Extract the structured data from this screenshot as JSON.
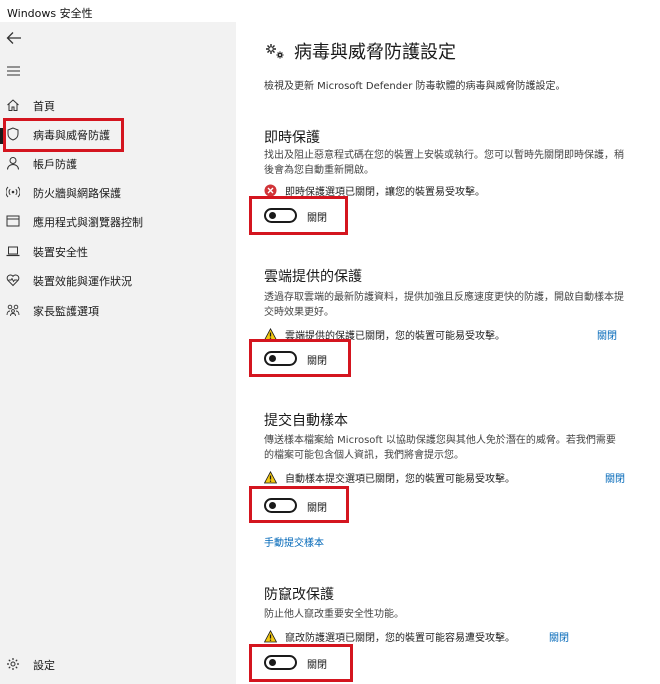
{
  "window": {
    "title": "Windows 安全性"
  },
  "sidebar": {
    "items": [
      {
        "label": "首頁",
        "icon": "home-icon"
      },
      {
        "label": "病毒與威脅防護",
        "icon": "shield-icon"
      },
      {
        "label": "帳戶防護",
        "icon": "person-icon"
      },
      {
        "label": "防火牆與網路保護",
        "icon": "wifi-icon"
      },
      {
        "label": "應用程式與瀏覽器控制",
        "icon": "app-window-icon"
      },
      {
        "label": "裝置安全性",
        "icon": "laptop-icon"
      },
      {
        "label": "裝置效能與運作狀況",
        "icon": "heart-pulse-icon"
      },
      {
        "label": "家長監護選項",
        "icon": "family-icon"
      }
    ],
    "settings": {
      "label": "設定",
      "icon": "gear-icon"
    }
  },
  "main": {
    "title": "病毒與威脅防護設定",
    "description": "檢視及更新 Microsoft Defender 防毒軟體的病毒與威脅防護設定。",
    "sections": [
      {
        "title": "即時保護",
        "description": "找出及阻止惡意程式碼在您的裝置上安裝或執行。您可以暫時先關閉即時保護，稍後會為您自動重新開啟。",
        "status": "即時保護選項已關閉，讓您的裝置易受攻擊。",
        "status_icon": "error-circle-icon",
        "link": "",
        "toggle_label": "關閉"
      },
      {
        "title": "雲端提供的保護",
        "description": "透過存取雲端的最新防護資料，提供加強且反應速度更快的防護，開啟自動樣本提交時效果更好。",
        "status": "雲端提供的保護已關閉，您的裝置可能易受攻擊。",
        "status_icon": "warning-icon",
        "link": "關閉",
        "toggle_label": "關閉"
      },
      {
        "title": "提交自動樣本",
        "description": "傳送樣本檔案給 Microsoft 以協助保護您與其他人免於潛在的威脅。若我們需要的檔案可能包含個人資訊，我們將會提示您。",
        "status": "自動樣本提交選項已關閉，您的裝置可能易受攻擊。",
        "status_icon": "warning-icon",
        "link": "關閉",
        "toggle_label": "關閉",
        "extra_link": "手動提交樣本"
      },
      {
        "title": "防竄改保護",
        "description": "防止他人竄改重要安全性功能。",
        "status": "竄改防護選項已關閉，您的裝置可能容易遭受攻擊。",
        "status_icon": "warning-icon",
        "link": "關閉",
        "toggle_label": "關閉"
      }
    ]
  },
  "colors": {
    "highlight": "#d4151f",
    "link": "#0067b8",
    "sidebar_bg": "#f2f2f2",
    "warning": "#f2c811",
    "error": "#d13438"
  }
}
